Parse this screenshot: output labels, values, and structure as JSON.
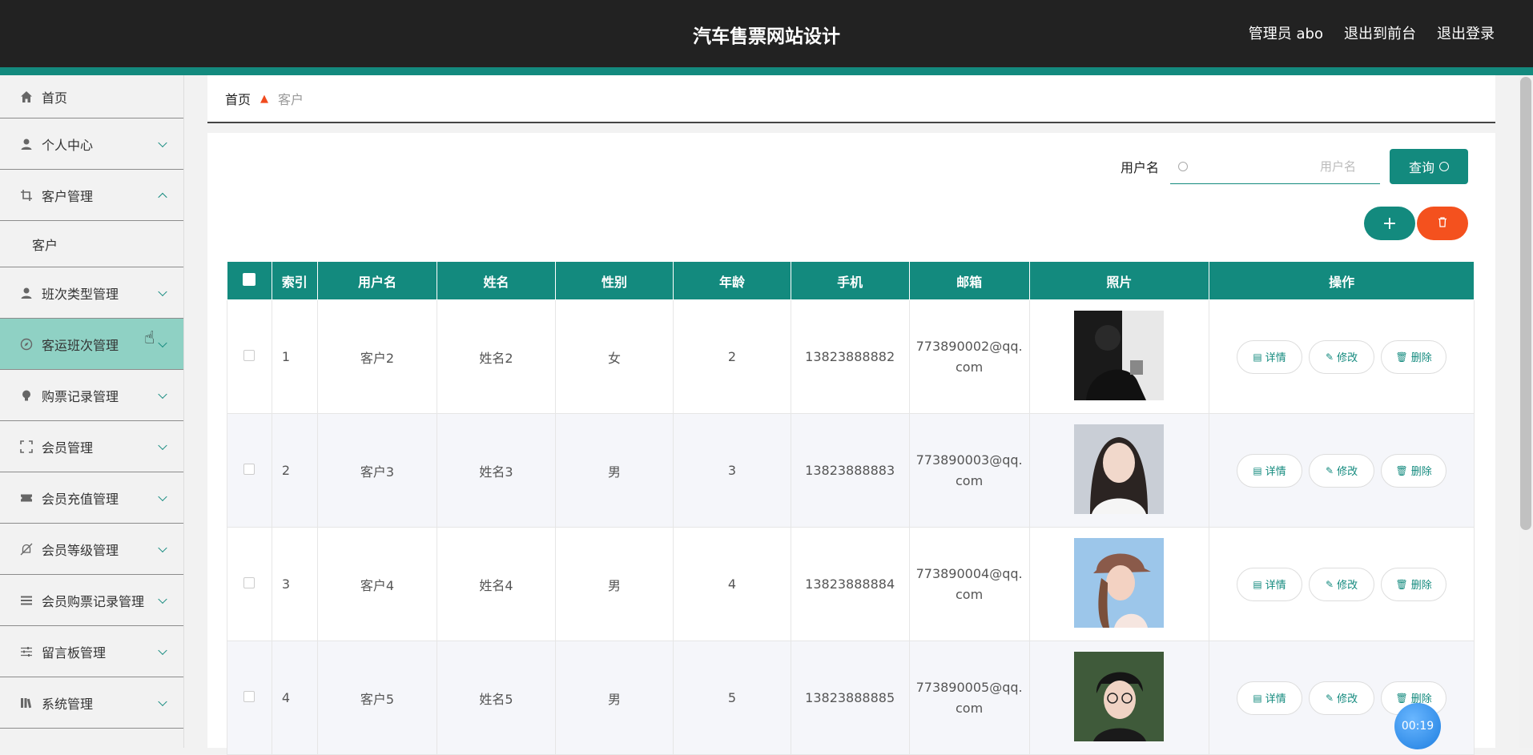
{
  "header": {
    "title": "汽车售票网站设计",
    "admin": "管理员 abo",
    "to_front": "退出到前台",
    "logout": "退出登录"
  },
  "sidebar": {
    "items": [
      {
        "label": "首页",
        "icon": "home-icon"
      },
      {
        "label": "个人中心",
        "icon": "user-icon"
      },
      {
        "label": "客户管理",
        "icon": "crop-icon",
        "expanded": true
      },
      {
        "label": "班次类型管理",
        "icon": "user-icon"
      },
      {
        "label": "客运班次管理",
        "icon": "compass-icon",
        "active": true
      },
      {
        "label": "购票记录管理",
        "icon": "bulb-icon"
      },
      {
        "label": "会员管理",
        "icon": "frame-icon"
      },
      {
        "label": "会员充值管理",
        "icon": "ticket-icon"
      },
      {
        "label": "会员等级管理",
        "icon": "bell-off-icon"
      },
      {
        "label": "会员购票记录管理",
        "icon": "list-icon"
      },
      {
        "label": "留言板管理",
        "icon": "sliders-icon"
      },
      {
        "label": "系统管理",
        "icon": "library-icon"
      }
    ],
    "sub_item": "客户"
  },
  "breadcrumb": {
    "home": "首页",
    "current": "客户"
  },
  "search": {
    "label": "用户名",
    "placeholder": "用户名",
    "button": "查询"
  },
  "table": {
    "headers": [
      "索引",
      "用户名",
      "姓名",
      "性别",
      "年龄",
      "手机",
      "邮箱",
      "照片",
      "操作"
    ],
    "rows": [
      {
        "index": "1",
        "username": "客户2",
        "name": "姓名2",
        "gender": "女",
        "age": "2",
        "phone": "13823888882",
        "email1": "773890002@qq.",
        "email2": "com"
      },
      {
        "index": "2",
        "username": "客户3",
        "name": "姓名3",
        "gender": "男",
        "age": "3",
        "phone": "13823888883",
        "email1": "773890003@qq.",
        "email2": "com"
      },
      {
        "index": "3",
        "username": "客户4",
        "name": "姓名4",
        "gender": "男",
        "age": "4",
        "phone": "13823888884",
        "email1": "773890004@qq.",
        "email2": "com"
      },
      {
        "index": "4",
        "username": "客户5",
        "name": "姓名5",
        "gender": "男",
        "age": "5",
        "phone": "13823888885",
        "email1": "773890005@qq.",
        "email2": "com"
      }
    ],
    "ops": {
      "detail": "详情",
      "edit": "修改",
      "delete": "删除"
    }
  },
  "timer": "00:19",
  "colors": {
    "primary": "#138a7e",
    "danger": "#f4511e",
    "header_bg": "#222222",
    "active_nav": "#8fd1c4"
  }
}
